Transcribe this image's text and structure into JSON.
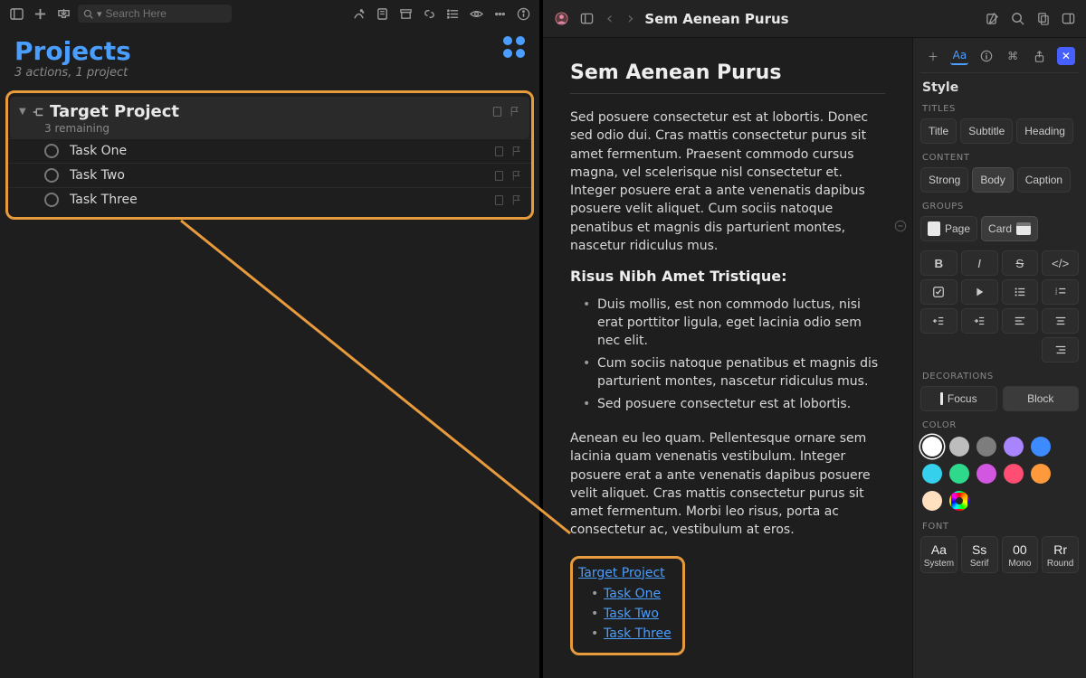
{
  "left": {
    "search_placeholder": "Search Here",
    "title": "Projects",
    "subtitle": "3 actions, 1 project",
    "project": {
      "name": "Target Project",
      "remaining": "3 remaining",
      "tasks": [
        "Task One",
        "Task Two",
        "Task Three"
      ]
    }
  },
  "doc": {
    "crumb_title": "Sem Aenean Purus",
    "title": "Sem Aenean Purus",
    "para1": "Sed posuere consectetur est at lobortis. Donec sed odio dui. Cras mattis consectetur purus sit amet fermentum. Praesent commodo cursus magna, vel scelerisque nisl consectetur et. Integer posuere erat a ante venenatis dapibus posuere velit aliquet. Cum sociis natoque penatibus et magnis dis parturient montes, nascetur ridiculus mus.",
    "heading2": "Risus Nibh Amet Tristique:",
    "bullets": [
      "Duis mollis, est non commodo luctus, nisi erat porttitor ligula, eget lacinia odio sem nec elit.",
      "Cum sociis natoque penatibus et magnis dis parturient montes, nascetur ridiculus mus.",
      "Sed posuere consectetur est at lobortis."
    ],
    "para2": "Aenean eu leo quam. Pellentesque ornare sem lacinia quam venenatis vestibulum. Integer posuere erat a ante venenatis dapibus posuere velit aliquet. Cras mattis consectetur purus sit amet fermentum. Morbi leo risus, porta ac consectetur ac, vestibulum at eros.",
    "linked_project": "Target Project",
    "linked_tasks": [
      "Task One",
      "Task Two",
      "Task Three"
    ]
  },
  "inspector": {
    "heading": "Style",
    "sections": {
      "titles": "TITLES",
      "content": "CONTENT",
      "groups": "GROUPS",
      "decorations": "DECORATIONS",
      "color": "COLOR",
      "font": "FONT"
    },
    "titles": [
      "Title",
      "Subtitle",
      "Heading"
    ],
    "content": [
      "Strong",
      "Body",
      "Caption"
    ],
    "content_selected": "Body",
    "groups": [
      "Page",
      "Card"
    ],
    "groups_selected": "Card",
    "decorations": [
      "Focus",
      "Block"
    ],
    "decorations_selected": "Block",
    "colors": [
      "#ffffff",
      "#bdbdbd",
      "#7d7d7d",
      "#a885ff",
      "#3d8bff",
      "#35d0ec",
      "#2fd98c",
      "#d257e0",
      "#ff4d73",
      "#ff9a3c",
      "#ffe0bf",
      "rainbow"
    ],
    "color_selected": "#ffffff",
    "fonts": [
      {
        "sample": "Aa",
        "label": "System"
      },
      {
        "sample": "Ss",
        "label": "Serif"
      },
      {
        "sample": "00",
        "label": "Mono"
      },
      {
        "sample": "Rr",
        "label": "Round"
      }
    ]
  }
}
